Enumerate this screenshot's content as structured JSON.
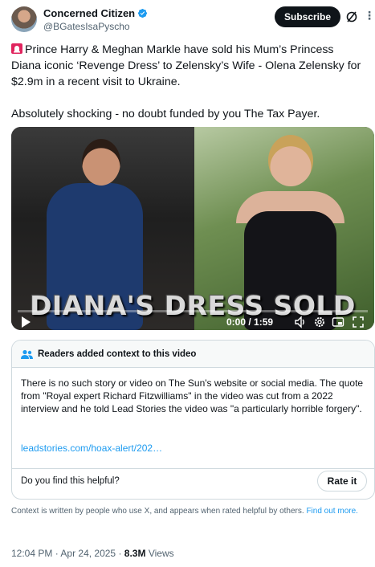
{
  "author": {
    "display_name": "Concerned Citizen",
    "handle": "@BGatesIsaPyscho",
    "verified": true,
    "avatar_icon": "avatar-photo"
  },
  "header": {
    "subscribe_label": "Subscribe",
    "grok_icon": "grok-icon",
    "more_icon": "more-icon"
  },
  "tweet": {
    "emoji_icon": "siren-icon",
    "paragraph1": "Prince Harry & Meghan Markle have sold his Mum’s Princess Diana iconic ‘Revenge Dress’ to Zelensky’s Wife - Olena Zelensky for $2.9m in a recent visit to Ukraine.",
    "paragraph2": "Absolutely shocking - no doubt funded by you The Tax Payer."
  },
  "video": {
    "overlay_title": "DIANA'S DRESS SOLD",
    "time": "0:00 / 1:59",
    "progress": 0.0,
    "controls": [
      "play-icon",
      "volume-icon",
      "settings-icon",
      "pip-icon",
      "fullscreen-icon"
    ]
  },
  "community_note": {
    "title": "Readers added context to this video",
    "body": "There is no such story or video on The Sun's website or social media. The quote from \"Royal expert Richard Fitzwilliams\" in the video was cut from a 2022 interview and he told Lead Stories the video was \"a particularly horrible forgery\".",
    "link": "leadstories.com/hoax-alert/202…",
    "helpful_question": "Do you find this helpful?",
    "rate_label": "Rate it"
  },
  "disclaimer": {
    "text": "Context is written by people who use X, and appears when rated helpful by others.",
    "link": "Find out more."
  },
  "meta": {
    "time": "12:04 PM",
    "separator1": " · ",
    "date": "Apr 24, 2025",
    "separator2": " · ",
    "views_count": "8.3M",
    "views_label": "Views"
  },
  "colors": {
    "accent": "#1d9bf0",
    "text": "#0f1419",
    "secondary": "#536471",
    "border": "#cfd9de"
  }
}
